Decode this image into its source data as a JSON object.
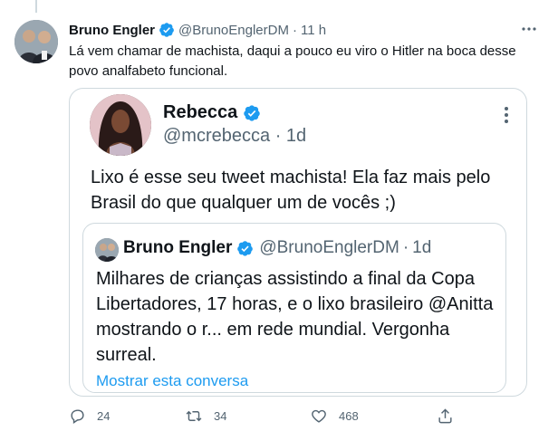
{
  "tweet": {
    "author_name": "Bruno Engler",
    "handle": "@BrunoEnglerDM",
    "time": "11 h",
    "text": "Lá vem chamar de machista, daqui a pouco eu viro o Hitler na boca desse povo analfabeto funcional."
  },
  "quote": {
    "author_name": "Rebecca",
    "handle": "@mcrebecca",
    "time": "1d",
    "text": "Lixo é esse seu tweet machista! Ela faz mais pelo Brasil do que qualquer um de vocês ;)"
  },
  "nested_quote": {
    "author_name": "Bruno Engler",
    "handle": "@BrunoEnglerDM",
    "time": "1d",
    "text": "Milhares de crianças assistindo a final da Copa Libertadores, 17 horas, e o lixo brasileiro @Anitta mostrando o r... em rede mundial. Vergonha surreal.",
    "show_thread": "Mostrar esta conversa"
  },
  "actions": {
    "replies": "24",
    "retweets": "34",
    "likes": "468"
  },
  "colors": {
    "accent": "#1d9bf0",
    "muted": "#536471",
    "border": "#cfd9de"
  }
}
